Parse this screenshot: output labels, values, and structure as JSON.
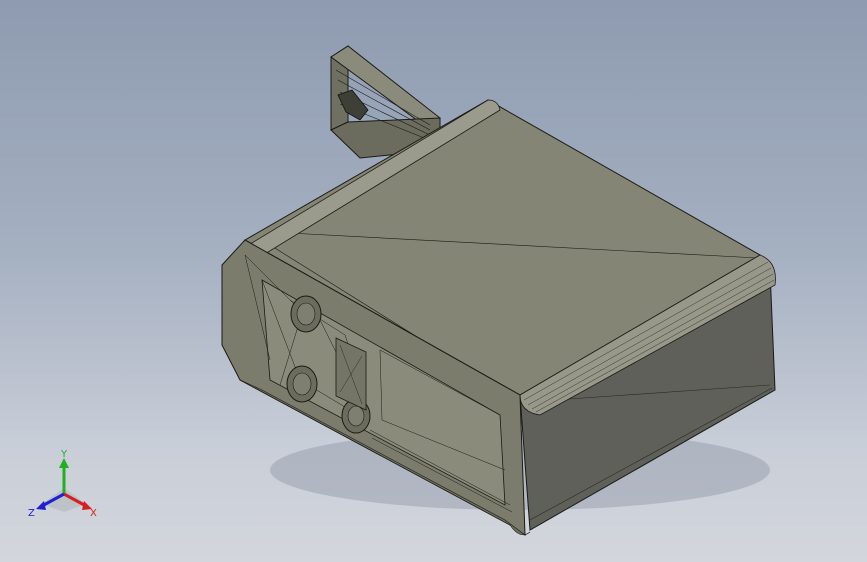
{
  "viewport": {
    "background_top": "#8e9bb0",
    "background_bottom": "#d3d6dc"
  },
  "model": {
    "face_color": "#848574",
    "edge_color": "#1a1a14"
  },
  "triad": {
    "x_label": "X",
    "y_label": "Y",
    "z_label": "Z",
    "x_color": "#d42020",
    "y_color": "#20b020",
    "z_color": "#2020d0"
  }
}
